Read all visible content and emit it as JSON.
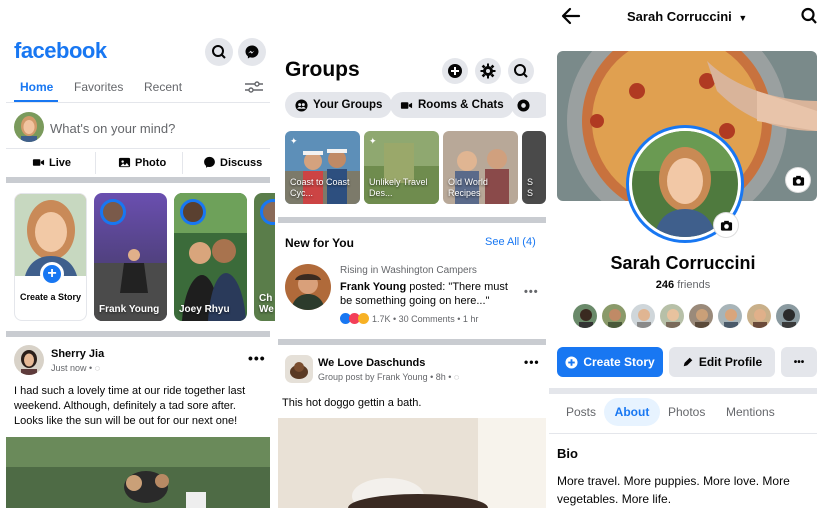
{
  "home": {
    "logo": "facebook",
    "tabs": [
      "Home",
      "Favorites",
      "Recent"
    ],
    "composer_placeholder": "What's on your mind?",
    "actions": [
      "Live",
      "Photo",
      "Discuss"
    ],
    "create_story_label": "Create a Story",
    "stories": [
      {
        "name": "Frank Young"
      },
      {
        "name": "Joey Rhyu"
      },
      {
        "name": "Ch We"
      }
    ],
    "post": {
      "author": "Sherry Jia",
      "meta": "Just now •",
      "text": "I had such a lovely time at our ride together last weekend. Although, definitely a tad sore after. Looks like the sun will be out for our next one!"
    }
  },
  "groups": {
    "title": "Groups",
    "pills": [
      "Your Groups",
      "Rooms & Chats"
    ],
    "thumbs": [
      {
        "title": "Coast to Coast Cyc..."
      },
      {
        "title": "Unlikely Travel Des..."
      },
      {
        "title": "Old World Recipes"
      },
      {
        "title": "S S"
      }
    ],
    "new_for_you": "New for You",
    "see_all": "See All (4)",
    "notif": {
      "context": "Rising in Washington Campers",
      "author": "Frank Young",
      "posted": " posted: \"There must be something going on here...\"",
      "stats": "1.7K • 30 Comments • 1 hr"
    },
    "post": {
      "group": "We Love Daschunds",
      "meta": "Group post by Frank Young • 8h •",
      "text": "This hot doggo gettin a bath."
    }
  },
  "profile": {
    "top_name": "Sarah Corruccini",
    "name": "Sarah Corruccini",
    "friends_count": "246",
    "friends_label": " friends",
    "create_story": "Create Story",
    "edit_profile": "Edit Profile",
    "more": "•••",
    "tabs": [
      "Posts",
      "About",
      "Photos",
      "Mentions"
    ],
    "bio_heading": "Bio",
    "bio_text": "More travel. More puppies. More love. More vegetables. More life."
  },
  "colors": {
    "brand": "#1877f2",
    "grey_button": "#e4e6eb",
    "secondary_text": "#65676b"
  }
}
